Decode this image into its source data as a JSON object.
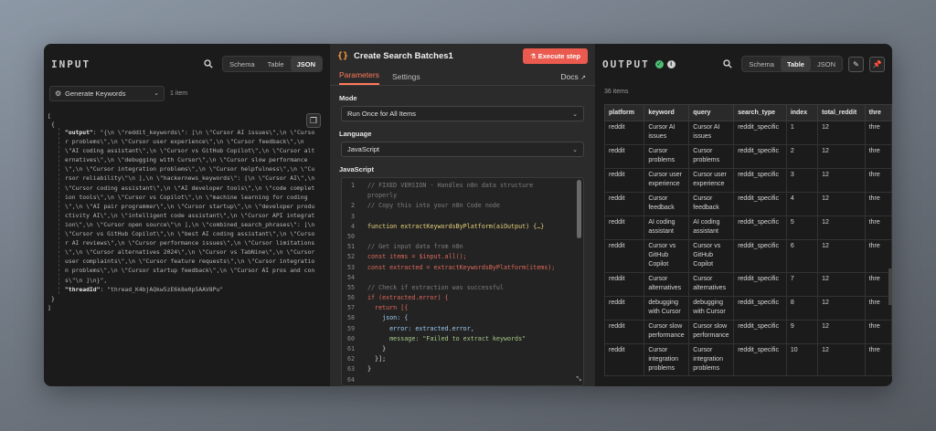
{
  "input": {
    "title": "INPUT",
    "view_modes": [
      "Schema",
      "Table",
      "JSON"
    ],
    "active_mode": "JSON",
    "node_selector": "Generate Keywords",
    "item_count": "1 item",
    "json_open": "[",
    "json_obj_open": "{",
    "output_key": "\"output\"",
    "output_value": "\"{\\n  \\\"reddit_keywords\\\": [\\n    \\\"Cursor AI issues\\\",\\n    \\\"Cursor problems\\\",\\n    \\\"Cursor user experience\\\",\\n    \\\"Cursor feedback\\\",\\n    \\\"AI coding assistant\\\",\\n    \\\"Cursor vs GitHub Copilot\\\",\\n    \\\"Cursor alternatives\\\",\\n    \\\"debugging with Cursor\\\",\\n    \\\"Cursor slow performance\\\",\\n    \\\"Cursor integration problems\\\",\\n    \\\"Cursor helpfulness\\\",\\n    \\\"Cursor reliability\\\"\\n  ],\\n  \\\"hackernews_keywords\\\": [\\n    \\\"Cursor AI\\\",\\n    \\\"Cursor coding assistant\\\",\\n    \\\"AI developer tools\\\",\\n    \\\"code completion tools\\\",\\n    \\\"Cursor vs Copilot\\\",\\n    \\\"machine learning for coding\\\",\\n    \\\"AI pair programmer\\\",\\n    \\\"Cursor startup\\\",\\n    \\\"developer productivity AI\\\",\\n    \\\"intelligent code assistant\\\",\\n    \\\"Cursor API integration\\\",\\n    \\\"Cursor open source\\\"\\n  ],\\n  \\\"combined_search_phrases\\\": [\\n    \\\"Cursor vs GitHub Copilot\\\",\\n    \\\"best AI coding assistant\\\",\\n    \\\"Cursor AI reviews\\\",\\n    \\\"Cursor performance issues\\\",\\n    \\\"Cursor limitations\\\",\\n    \\\"Cursor alternatives 2024\\\",\\n    \\\"Cursor vs TabNine\\\",\\n    \\\"Cursor user complaints\\\",\\n    \\\"Cursor feature requests\\\",\\n    \\\"Cursor integration problems\\\",\\n    \\\"Cursor startup feedback\\\",\\n    \\\"Cursor AI pros and cons\\\"\\n  ]\\n}\",",
    "thread_key": "\"threadId\"",
    "thread_value": "\"thread_K4bjAQkw5zE6k8e0p5AAV8Pu\"",
    "json_obj_close": "}",
    "json_close": "]"
  },
  "node": {
    "title": "Create Search Batches1",
    "execute_label": "Execute step",
    "tabs": [
      "Parameters",
      "Settings"
    ],
    "active_tab": "Parameters",
    "docs_label": "Docs",
    "mode_label": "Mode",
    "mode_value": "Run Once for All Items",
    "language_label": "Language",
    "language_value": "JavaScript",
    "code_label": "JavaScript",
    "code_lines": [
      {
        "n": "1",
        "t": "// FIXED VERSION - Handles n8n data structure",
        "k": "comment"
      },
      {
        "n": "",
        "t": "properly",
        "k": "comment"
      },
      {
        "n": "2",
        "t": "// Copy this into your n8n Code node",
        "k": "comment"
      },
      {
        "n": "3",
        "t": "",
        "k": "plain"
      },
      {
        "n": "4",
        "t": "function extractKeywordsByPlatform(aiOutput) {…}",
        "k": "fn"
      },
      {
        "n": "50",
        "t": "",
        "k": "plain"
      },
      {
        "n": "51",
        "t": "// Get input data from n8n",
        "k": "comment"
      },
      {
        "n": "52",
        "t": "const items = $input.all();",
        "k": "const"
      },
      {
        "n": "53",
        "t": "const extracted = extractKeywordsByPlatform(items);",
        "k": "const"
      },
      {
        "n": "54",
        "t": "",
        "k": "plain"
      },
      {
        "n": "55",
        "t": "// Check if extraction was successful",
        "k": "comment"
      },
      {
        "n": "56",
        "t": "if (extracted.error) {",
        "k": "if"
      },
      {
        "n": "57",
        "t": "  return [{",
        "k": "return"
      },
      {
        "n": "58",
        "t": "    json: {",
        "k": "prop"
      },
      {
        "n": "59",
        "t": "      error: extracted.error,",
        "k": "prop"
      },
      {
        "n": "60",
        "t": "      message: \"Failed to extract keywords\"",
        "k": "propstr"
      },
      {
        "n": "61",
        "t": "    }",
        "k": "plain"
      },
      {
        "n": "62",
        "t": "  }];",
        "k": "plain"
      },
      {
        "n": "63",
        "t": "}",
        "k": "plain"
      },
      {
        "n": "64",
        "t": "",
        "k": "plain"
      }
    ]
  },
  "output": {
    "title": "OUTPUT",
    "view_modes": [
      "Schema",
      "Table",
      "JSON"
    ],
    "active_mode": "Table",
    "item_count": "36 items",
    "columns": [
      "platform",
      "keyword",
      "query",
      "search_type",
      "index",
      "total_reddit",
      "thre"
    ],
    "rows": [
      [
        "reddit",
        "Cursor AI issues",
        "Cursor AI issues",
        "reddit_specific",
        "1",
        "12",
        "thre"
      ],
      [
        "reddit",
        "Cursor problems",
        "Cursor problems",
        "reddit_specific",
        "2",
        "12",
        "thre"
      ],
      [
        "reddit",
        "Cursor user experience",
        "Cursor user experience",
        "reddit_specific",
        "3",
        "12",
        "thre"
      ],
      [
        "reddit",
        "Cursor feedback",
        "Cursor feedback",
        "reddit_specific",
        "4",
        "12",
        "thre"
      ],
      [
        "reddit",
        "AI coding assistant",
        "AI coding assistant",
        "reddit_specific",
        "5",
        "12",
        "thre"
      ],
      [
        "reddit",
        "Cursor vs GitHub Copilot",
        "Cursor vs GitHub Copilot",
        "reddit_specific",
        "6",
        "12",
        "thre"
      ],
      [
        "reddit",
        "Cursor alternatives",
        "Cursor alternatives",
        "reddit_specific",
        "7",
        "12",
        "thre"
      ],
      [
        "reddit",
        "debugging with Cursor",
        "debugging with Cursor",
        "reddit_specific",
        "8",
        "12",
        "thre"
      ],
      [
        "reddit",
        "Cursor slow performance",
        "Cursor slow performance",
        "reddit_specific",
        "9",
        "12",
        "thre"
      ],
      [
        "reddit",
        "Cursor integration problems",
        "Cursor integration problems",
        "reddit_specific",
        "10",
        "12",
        "thre"
      ]
    ]
  },
  "colors": {
    "accent": "#ea5a4e",
    "tab_active": "#ff7a5a",
    "success": "#4cbd74",
    "node_icon": "#ff9d3b"
  }
}
